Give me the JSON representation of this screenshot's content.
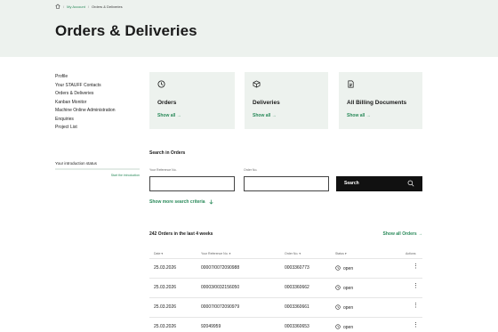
{
  "breadcrumb": {
    "home_icon": "home-icon",
    "items": [
      "My Account",
      "Orders & Deliveries"
    ]
  },
  "page_title": "Orders & Deliveries",
  "sidebar": {
    "items": [
      {
        "label": "Profile"
      },
      {
        "label": "Your STAUFF Contacts"
      },
      {
        "label": "Orders & Deliveries"
      },
      {
        "label": "Kanban Monitor"
      },
      {
        "label": "Machine Online Administration"
      },
      {
        "label": "Enquiries"
      },
      {
        "label": "Project List"
      }
    ],
    "intro": {
      "label": "Your introduction status",
      "progress": 0.0,
      "link": "Start the introduction"
    }
  },
  "cards": [
    {
      "title": "Orders",
      "link": "Show all",
      "icon": "clock-icon"
    },
    {
      "title": "Deliveries",
      "link": "Show all",
      "icon": "box-icon"
    },
    {
      "title": "All Billing Documents",
      "link": "Show all",
      "icon": "document-icon"
    }
  ],
  "search": {
    "title": "Search in Orders",
    "ref_label": "Your Reference No.",
    "ref_value": "",
    "order_label": "Order No.",
    "order_value": "",
    "button": "Search",
    "more": "Show more search criteria"
  },
  "orders": {
    "count_text": "242 Orders in the last 4 weeks",
    "show_all": "Show all Orders",
    "columns": [
      "Date",
      "Your Reference No.",
      "Order No.",
      "Status",
      "Actions"
    ],
    "rows": [
      {
        "date": "25.03.2026",
        "ref": "00007/0072090988",
        "order": "0003360773",
        "status": "open"
      },
      {
        "date": "25.03.2026",
        "ref": "00003/0032156050",
        "order": "0003360662",
        "status": "open"
      },
      {
        "date": "25.03.2026",
        "ref": "00007/0072090979",
        "order": "0003360661",
        "status": "open"
      },
      {
        "date": "25.03.2026",
        "ref": "92049959",
        "order": "0003360653",
        "status": "open"
      }
    ]
  },
  "colors": {
    "accent": "#2a8a5a",
    "hero_bg": "#edf2ee",
    "button_bg": "#111111"
  }
}
